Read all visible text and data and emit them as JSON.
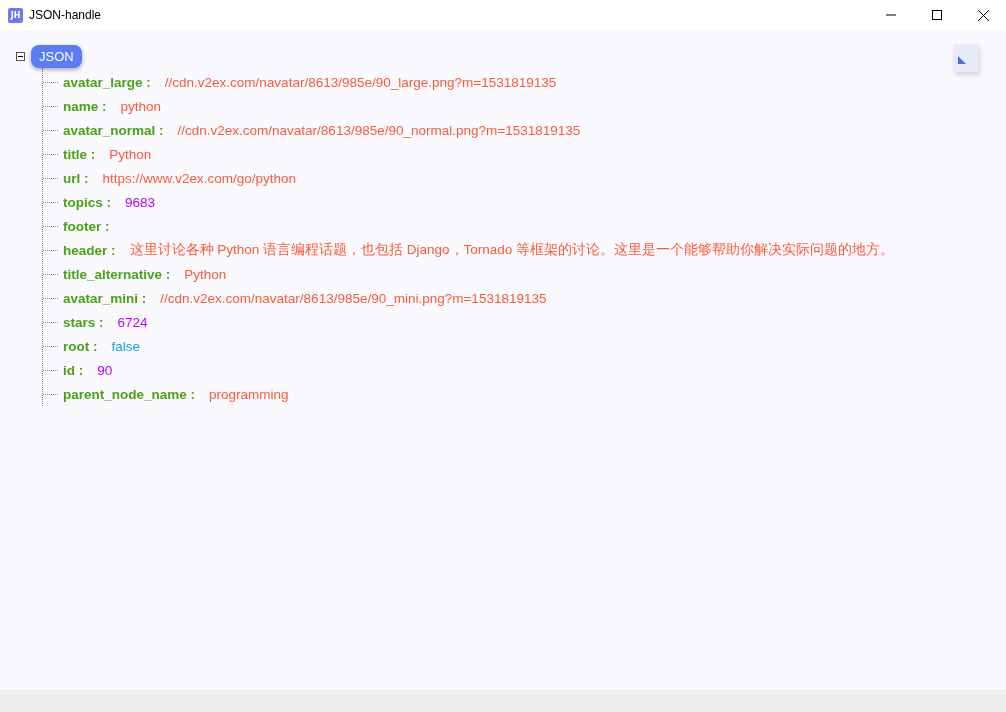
{
  "window": {
    "app_icon": "JH",
    "title": "JSON-handle"
  },
  "tree": {
    "root": "JSON",
    "expanded": true,
    "items": [
      {
        "key": "avatar_large :",
        "kind": "string",
        "value": "//cdn.v2ex.com/navatar/8613/985e/90_large.png?m=1531819135"
      },
      {
        "key": "name :",
        "kind": "string",
        "value": "python"
      },
      {
        "key": "avatar_normal :",
        "kind": "string",
        "value": "//cdn.v2ex.com/navatar/8613/985e/90_normal.png?m=1531819135"
      },
      {
        "key": "title :",
        "kind": "string",
        "value": "Python"
      },
      {
        "key": "url :",
        "kind": "string",
        "value": "https://www.v2ex.com/go/python"
      },
      {
        "key": "topics :",
        "kind": "number",
        "value": "9683"
      },
      {
        "key": "footer :"
      },
      {
        "key": "header :",
        "kind": "string",
        "value": "这里讨论各种 Python 语言编程话题，也包括 Django，Tornado 等框架的讨论。这里是一个能够帮助你解决实际问题的地方。"
      },
      {
        "key": "title_alternative :",
        "kind": "string",
        "value": "Python"
      },
      {
        "key": "avatar_mini :",
        "kind": "string",
        "value": "//cdn.v2ex.com/navatar/8613/985e/90_mini.png?m=1531819135"
      },
      {
        "key": "stars :",
        "kind": "number",
        "value": "6724"
      },
      {
        "key": "root :",
        "kind": "boolean",
        "value": "false"
      },
      {
        "key": "id :",
        "kind": "number",
        "value": "90"
      },
      {
        "key": "parent_node_name :",
        "kind": "string",
        "value": "programming"
      }
    ]
  }
}
